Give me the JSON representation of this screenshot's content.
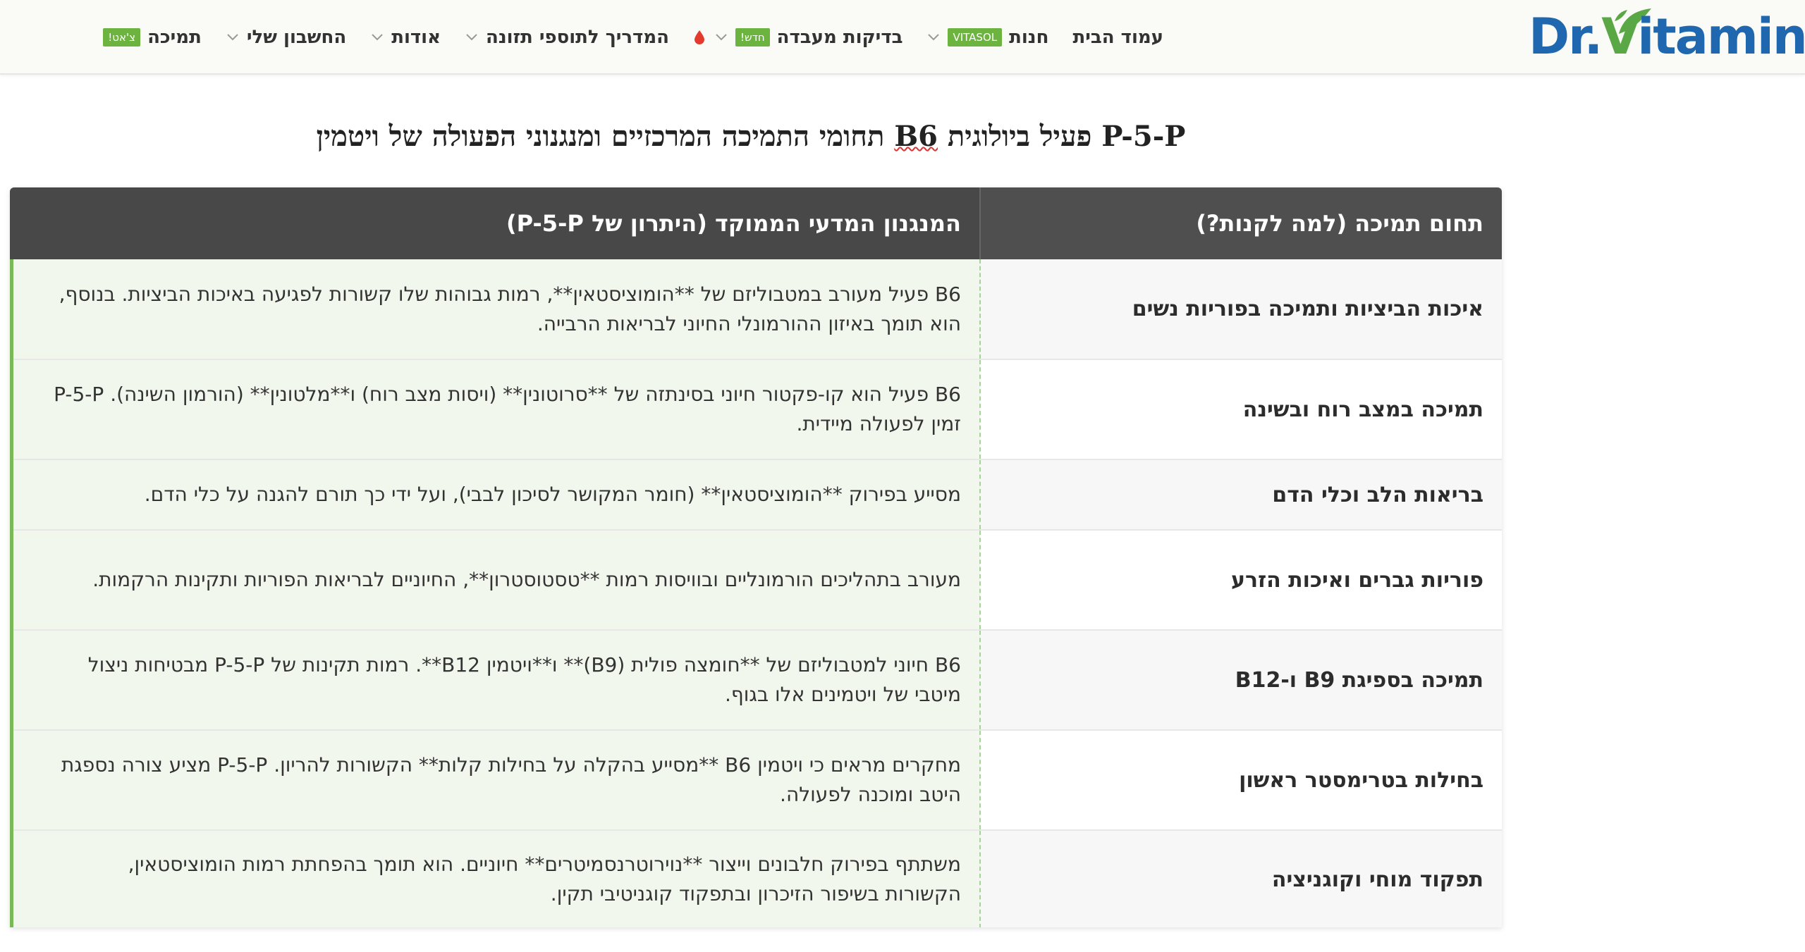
{
  "header": {
    "logo_text_pre": "Dr.",
    "logo_text_v": "V",
    "logo_text_post": "itamin",
    "nav": [
      {
        "label": "עמוד הבית"
      },
      {
        "label": "חנות",
        "badge": "VITASOL"
      },
      {
        "label": "בדיקות מעבדה",
        "badge": "חדש!"
      },
      {
        "label": "המדריך לתוספי תזונה"
      },
      {
        "label": "אודות"
      },
      {
        "label": "החשבון שלי"
      },
      {
        "label": "תמיכה",
        "badge": "צ'אט!"
      }
    ]
  },
  "title": {
    "part1": "P-5-P פעיל ביולוגית",
    "part2": "B6",
    "part3": "תחומי התמיכה המרכזיים ומנגנוני הפעולה של ויטמין"
  },
  "table": {
    "headers": {
      "area": "תחום תמיכה (למה לקנות?)",
      "mechanism": "המנגנון המדעי הממוקד (היתרון של P-5-P)"
    },
    "rows": [
      {
        "area": "איכות הביציות ותמיכה בפוריות נשים",
        "mechanism": "B6 פעיל מעורב במטבוליזם של **הומוציסטאין**, רמות גבוהות שלו קשורות לפגיעה באיכות הביציות. בנוסף, הוא תומך באיזון ההורמונלי החיוני לבריאות הרבייה."
      },
      {
        "area": "תמיכה במצב רוח ובשינה",
        "mechanism": "B6 פעיל הוא קו-פקטור חיוני בסינתזה של **סרוטונין** (ויסות מצב רוח) ו**מלטונין** (הורמון השינה). P-5-P זמין לפעולה מיידית."
      },
      {
        "area": "בריאות הלב וכלי הדם",
        "mechanism": "מסייע בפירוק **הומוציסטאין** (חומר המקושר לסיכון לבבי), ועל ידי כך תורם להגנה על כלי הדם."
      },
      {
        "area": "פוריות גברים ואיכות הזרע",
        "mechanism": "מעורב בתהליכים הורמונליים ובוויסות רמות **טסטוסטרון**, החיוניים לבריאות הפוריות ותקינות הרקמות."
      },
      {
        "area": "תמיכה בספיגת B9 ו-B12",
        "mechanism": "B6 חיוני למטבוליזם של **חומצה פולית (B9)** ו**ויטמין B12**. רמות תקינות של P-5-P מבטיחות ניצול מיטבי של ויטמינים אלו בגוף."
      },
      {
        "area": "בחילות בטרימסטר ראשון",
        "mechanism": "מחקרים מראים כי ויטמין B6 **מסייע בהקלה על בחילות קלות** הקשורות להריון. P-5-P מציע צורה נספגת היטב ומוכנה לפעולה."
      },
      {
        "area": "תפקוד מוחי וקוגניציה",
        "mechanism": "משתתף בפירוק חלבונים וייצור **נוירוטרנסמיטרים** חיוניים. הוא תומך בהפחתת רמות הומוציסטאין, הקשורות בשיפור הזיכרון ובתפקוד קוגניטיבי תקין."
      }
    ]
  },
  "colors": {
    "brand_blue": "#1f67ae",
    "brand_green": "#5aa845",
    "header_dark": "#4f4f4f",
    "badge_green": "#6db33f"
  }
}
